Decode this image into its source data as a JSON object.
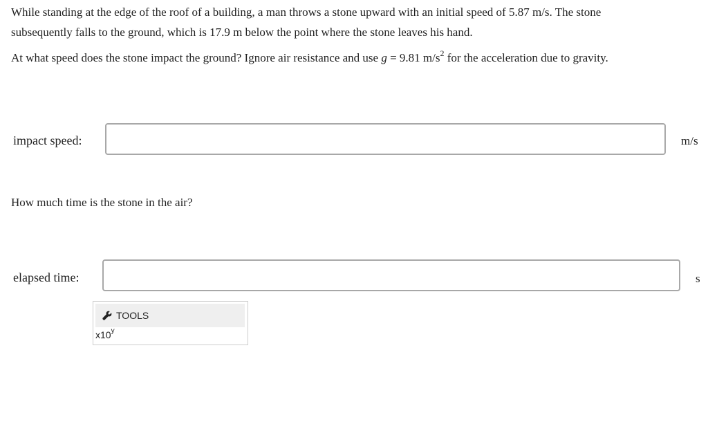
{
  "problem": {
    "intro_line1": "While standing at the edge of the roof of a building, a man throws a stone upward with an initial speed of 5.87 m/s. The stone",
    "intro_line2": "subsequently falls to the ground, which is 17.9 m below the point where the stone leaves his hand.",
    "q1_before_var": "At what speed does the stone impact the ground? Ignore air resistance and use ",
    "q1_var": "g",
    "q1_after_var": " = 9.81 m/s",
    "q1_sup": "2",
    "q1_end": " for the acceleration due to gravity.",
    "q2": "How much time is the stone in the air?"
  },
  "answers": {
    "impact": {
      "label": "impact speed:",
      "value": "",
      "unit": "m/s"
    },
    "elapsed": {
      "label": "elapsed time:",
      "value": "",
      "unit": "s"
    }
  },
  "tools": {
    "label": "TOOLS",
    "sci_base": "x10",
    "sci_exp": "y"
  },
  "icons": {
    "tools": "wrench-icon"
  }
}
